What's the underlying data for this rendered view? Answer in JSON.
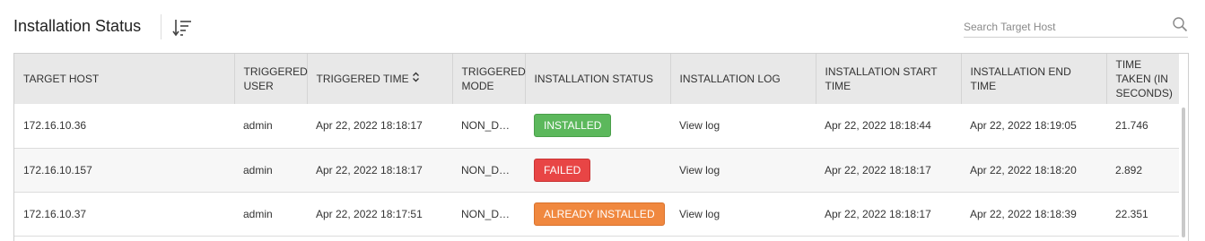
{
  "header": {
    "title": "Installation Status",
    "sort_icon": "sort-descending-icon"
  },
  "search": {
    "placeholder": "Search Target Host",
    "value": "",
    "icon": "search-icon"
  },
  "table": {
    "columns": [
      {
        "key": "target_host",
        "label": "TARGET HOST"
      },
      {
        "key": "triggered_user",
        "label": "TRIGGERED USER"
      },
      {
        "key": "triggered_time",
        "label": "TRIGGERED TIME",
        "sortable": true
      },
      {
        "key": "triggered_mode",
        "label": "TRIGGERED MODE"
      },
      {
        "key": "installation_status",
        "label": "INSTALLATION STATUS"
      },
      {
        "key": "installation_log",
        "label": "INSTALLATION LOG"
      },
      {
        "key": "start_time",
        "label": "INSTALLATION START TIME"
      },
      {
        "key": "end_time",
        "label": "INSTALLATION END TIME"
      },
      {
        "key": "time_taken",
        "label": "TIME TAKEN (IN SECONDS)"
      }
    ],
    "rows": [
      {
        "target_host": "172.16.10.36",
        "triggered_user": "admin",
        "triggered_time": "Apr 22, 2022 18:18:17",
        "triggered_mode": "NON_DO...",
        "status": {
          "label": "INSTALLED",
          "color": "#5cb85c",
          "border": "#4a9f4a"
        },
        "log": "View log",
        "start_time": "Apr 22, 2022 18:18:44",
        "end_time": "Apr 22, 2022 18:19:05",
        "time_taken": "21.746"
      },
      {
        "target_host": "172.16.10.157",
        "triggered_user": "admin",
        "triggered_time": "Apr 22, 2022 18:18:17",
        "triggered_mode": "NON_DO...",
        "status": {
          "label": "FAILED",
          "color": "#e84545",
          "border": "#c93434"
        },
        "log": "View log",
        "start_time": "Apr 22, 2022 18:18:17",
        "end_time": "Apr 22, 2022 18:18:20",
        "time_taken": "2.892"
      },
      {
        "target_host": "172.16.10.37",
        "triggered_user": "admin",
        "triggered_time": "Apr 22, 2022 18:17:51",
        "triggered_mode": "NON_DO...",
        "status": {
          "label": "ALREADY INSTALLED",
          "color": "#f0883f",
          "border": "#d9722c"
        },
        "log": "View log",
        "start_time": "Apr 22, 2022 18:18:17",
        "end_time": "Apr 22, 2022 18:18:39",
        "time_taken": "22.351"
      }
    ]
  }
}
